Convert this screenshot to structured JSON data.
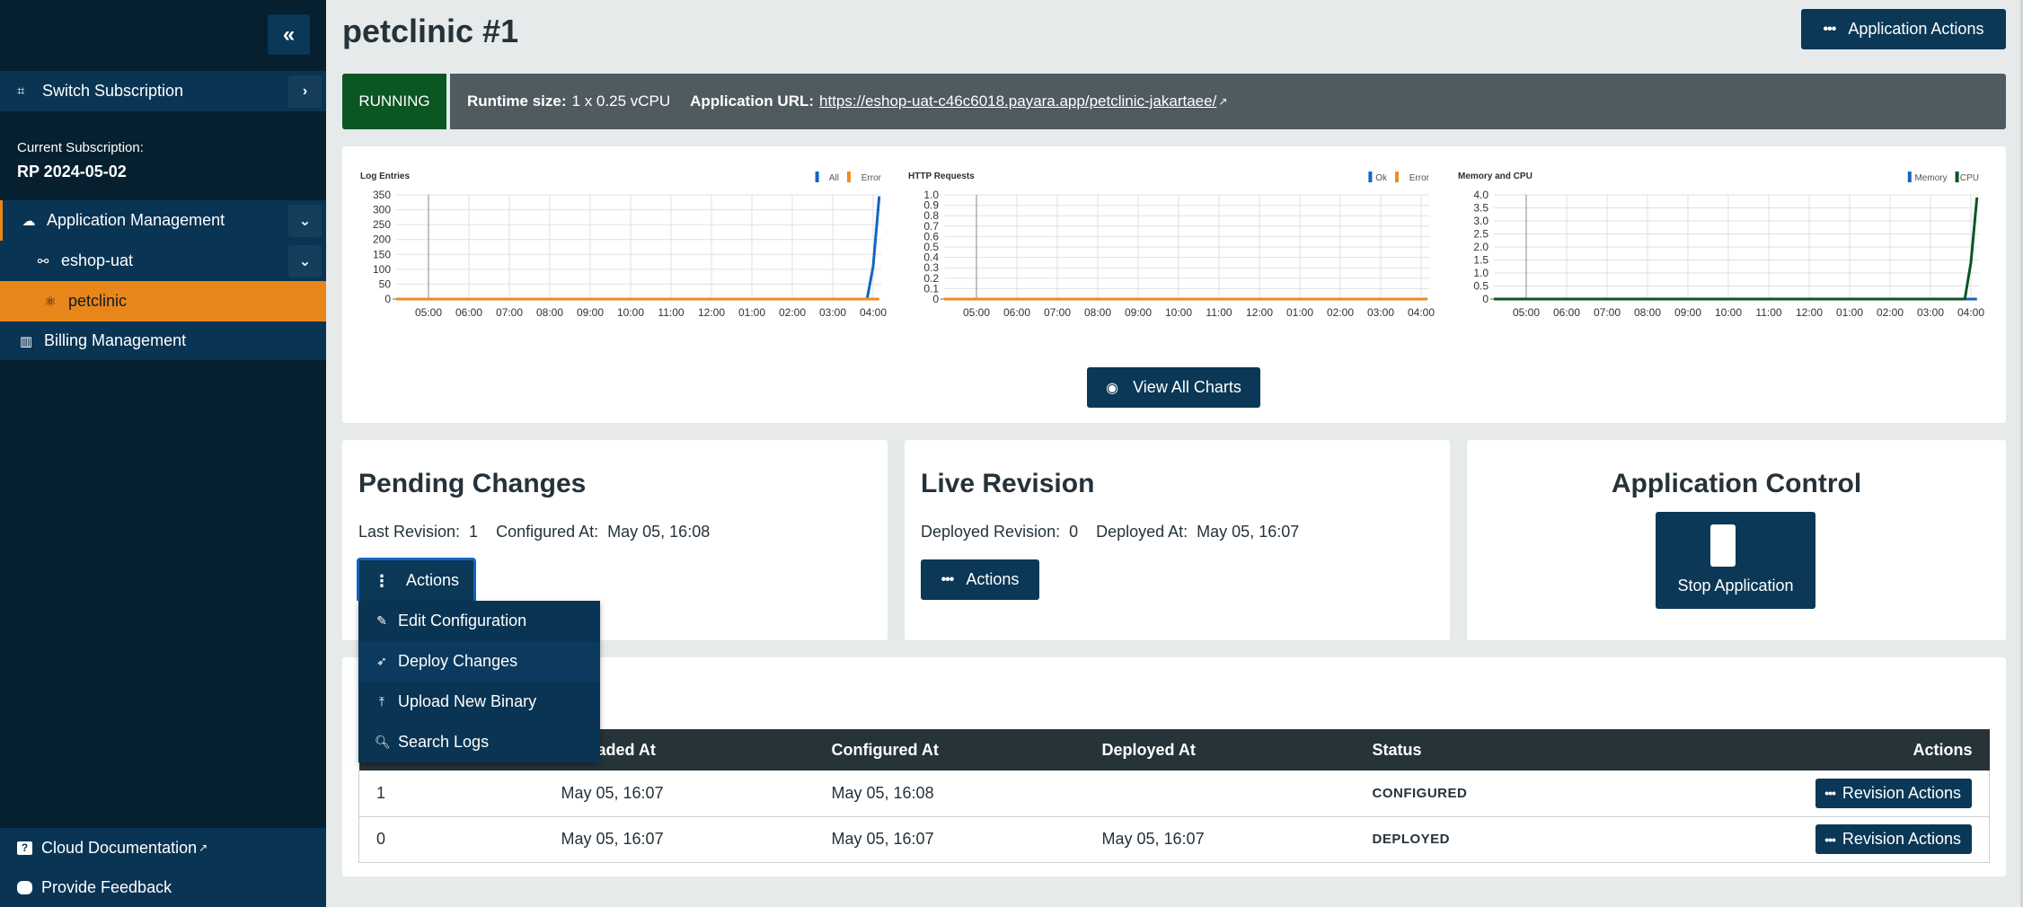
{
  "sidebar": {
    "collapse_icon": "double-chevron-left-icon",
    "switch_subscription": "Switch Subscription",
    "current_subscription_label": "Current Subscription:",
    "current_subscription_value": "RP 2024-05-02",
    "nav": {
      "application_management": "Application Management",
      "environment": "eshop-uat",
      "application": "petclinic",
      "billing_management": "Billing Management"
    },
    "bottom": {
      "cloud_documentation": "Cloud Documentation",
      "provide_feedback": "Provide Feedback"
    }
  },
  "header": {
    "title": "petclinic #1",
    "application_actions": "Application Actions"
  },
  "status": {
    "state": "RUNNING",
    "runtime_label": "Runtime size:",
    "runtime_value": "1 x 0.25 vCPU",
    "url_label": "Application URL:",
    "url_value": "https://eshop-uat-c46c6018.payara.app/petclinic-jakartaee/"
  },
  "colors": {
    "brand": "#0a3856",
    "running": "#0b5622",
    "accent": "#e8861a",
    "series_blue": "#1565c0",
    "series_orange": "#f08c1e",
    "series_green": "#0b5622"
  },
  "chart_data": [
    {
      "type": "line",
      "title": "Log Entries",
      "x": [
        "05:00",
        "06:00",
        "07:00",
        "08:00",
        "09:00",
        "10:00",
        "11:00",
        "12:00",
        "01:00",
        "02:00",
        "03:00",
        "04:00"
      ],
      "ylim": [
        0,
        350
      ],
      "yticks": [
        "0",
        "50",
        "100",
        "150",
        "200",
        "250",
        "300",
        "350"
      ],
      "grid": true,
      "legend": "top-right",
      "series": [
        {
          "name": "All",
          "color": "#1565c0",
          "points": [
            [
              -0.8,
              0
            ],
            [
              10.85,
              0
            ],
            [
              11.0,
              110
            ],
            [
              11.15,
              345
            ]
          ]
        },
        {
          "name": "Error",
          "color": "#f08c1e",
          "points": [
            [
              -0.8,
              0
            ],
            [
              11.15,
              0
            ]
          ]
        }
      ]
    },
    {
      "type": "line",
      "title": "HTTP Requests",
      "x": [
        "05:00",
        "06:00",
        "07:00",
        "08:00",
        "09:00",
        "10:00",
        "11:00",
        "12:00",
        "01:00",
        "02:00",
        "03:00",
        "04:00"
      ],
      "ylim": [
        0,
        1.0
      ],
      "yticks": [
        "0",
        "0.1",
        "0.2",
        "0.3",
        "0.4",
        "0.5",
        "0.6",
        "0.7",
        "0.8",
        "0.9",
        "1.0"
      ],
      "grid": true,
      "legend": "top-right",
      "series": [
        {
          "name": "Ok",
          "color": "#1565c0",
          "points": [
            [
              -0.8,
              0
            ],
            [
              11.15,
              0
            ]
          ]
        },
        {
          "name": "Error",
          "color": "#f08c1e",
          "points": [
            [
              -0.8,
              0
            ],
            [
              11.15,
              0
            ]
          ]
        }
      ]
    },
    {
      "type": "line",
      "title": "Memory and CPU",
      "x": [
        "05:00",
        "06:00",
        "07:00",
        "08:00",
        "09:00",
        "10:00",
        "11:00",
        "12:00",
        "01:00",
        "02:00",
        "03:00",
        "04:00"
      ],
      "ylim": [
        0,
        4.0
      ],
      "yticks": [
        "0",
        "0.5",
        "1.0",
        "1.5",
        "2.0",
        "2.5",
        "3.0",
        "3.5",
        "4.0"
      ],
      "grid": true,
      "legend": "top-right",
      "series": [
        {
          "name": "Memory",
          "color": "#1565c0",
          "points": [
            [
              -0.8,
              0
            ],
            [
              11.15,
              0
            ]
          ]
        },
        {
          "name": "CPU",
          "color": "#0b5622",
          "points": [
            [
              -0.8,
              0
            ],
            [
              10.85,
              0
            ],
            [
              11.0,
              1.4
            ],
            [
              11.15,
              3.9
            ]
          ]
        }
      ]
    }
  ],
  "charts": {
    "view_all": "View All Charts"
  },
  "pending": {
    "title": "Pending Changes",
    "meta": "Last Revision:  1    Configured At:  May 05, 16:08",
    "actions": "Actions",
    "menu": [
      "Edit Configuration",
      "Deploy Changes",
      "Upload New Binary",
      "Search Logs"
    ]
  },
  "live": {
    "title": "Live Revision",
    "meta": "Deployed Revision:  0    Deployed At:  May 05, 16:07",
    "actions": "Actions"
  },
  "control": {
    "title": "Application Control",
    "stop": "Stop Application"
  },
  "revisions": {
    "headers": [
      "",
      "Uploaded At",
      "Configured At",
      "Deployed At",
      "Status",
      "Actions"
    ],
    "rows": [
      {
        "rev": "1",
        "uploaded": "May 05, 16:07",
        "configured": "May 05, 16:08",
        "deployed": "",
        "status": "CONFIGURED",
        "action": "Revision Actions"
      },
      {
        "rev": "0",
        "uploaded": "May 05, 16:07",
        "configured": "May 05, 16:07",
        "deployed": "May 05, 16:07",
        "status": "DEPLOYED",
        "action": "Revision Actions"
      }
    ]
  }
}
